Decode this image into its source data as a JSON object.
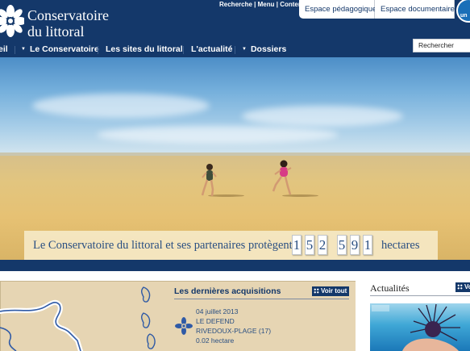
{
  "header": {
    "logo_line1": "Conservatoire",
    "logo_line2": "du littoral",
    "top_links": [
      "Recherche",
      "Menu",
      "Contenu"
    ],
    "top_sep": " | ",
    "tabs": [
      "Espace pédagogique",
      "Espace documentaire"
    ],
    "badge_text": "un"
  },
  "nav": {
    "items": [
      {
        "label": "eil",
        "has_arrow": false
      },
      {
        "label": "Le Conservatoire",
        "has_arrow": true
      },
      {
        "label": "Les sites du littoral",
        "has_arrow": false
      },
      {
        "label": "L'actualité",
        "has_arrow": false
      },
      {
        "label": "Dossiers",
        "has_arrow": true
      }
    ],
    "arrow_glyph": "▼"
  },
  "search": {
    "value": "Rechercher"
  },
  "hero": {
    "banner_text": "Le Conservatoire du littoral et ses partenaires protègent",
    "counter_digits": [
      "1",
      "5",
      "2",
      "5",
      "9",
      "1"
    ],
    "unit": "hectares"
  },
  "acquisitions": {
    "title": "Les dernières acquisitions",
    "voir_tout": "Voir tout",
    "item": {
      "date": "04 juillet 2013",
      "name": "LE DEFEND",
      "place": "RIVEDOUX-PLAGE (17)",
      "area": "0.02 hectare"
    }
  },
  "actualites": {
    "title": "Actualités",
    "voir_tout": "Vo"
  },
  "colors": {
    "header_bg": "#14386a",
    "accent_text": "#2a4f82",
    "map_bg": "#e6d5b3"
  }
}
